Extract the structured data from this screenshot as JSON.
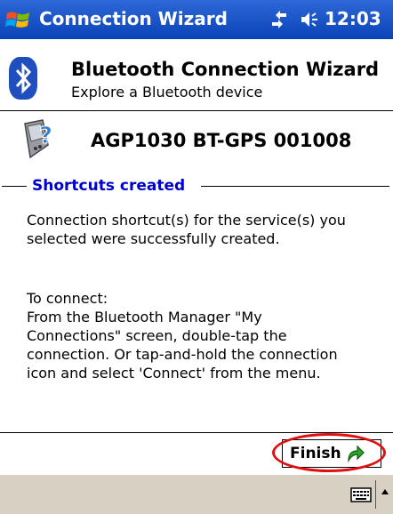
{
  "titlebar": {
    "title": "Connection Wizard",
    "time": "12:03",
    "bg_color": "#0a43b8"
  },
  "header": {
    "title": "Bluetooth Connection Wizard",
    "subtitle": "Explore a Bluetooth device"
  },
  "device": {
    "name": "AGP1030 BT-GPS 001008"
  },
  "section": {
    "title": "Shortcuts created",
    "title_color": "#0000cc"
  },
  "body": {
    "line1": "Connection shortcut(s)  for the service(s) you",
    "line2": "selected were successfully created.",
    "connect_head": "To connect:",
    "step1": "From the Bluetooth Manager \"My",
    "step2": "Connections\" screen, double-tap the",
    "step3": "connection. Or tap-and-hold the connection",
    "step4": "icon and select 'Connect' from the menu."
  },
  "buttons": {
    "finish": "Finish",
    "highlight_color": "#e01010"
  },
  "menubar": {
    "bg_color": "#d8d0c2"
  }
}
